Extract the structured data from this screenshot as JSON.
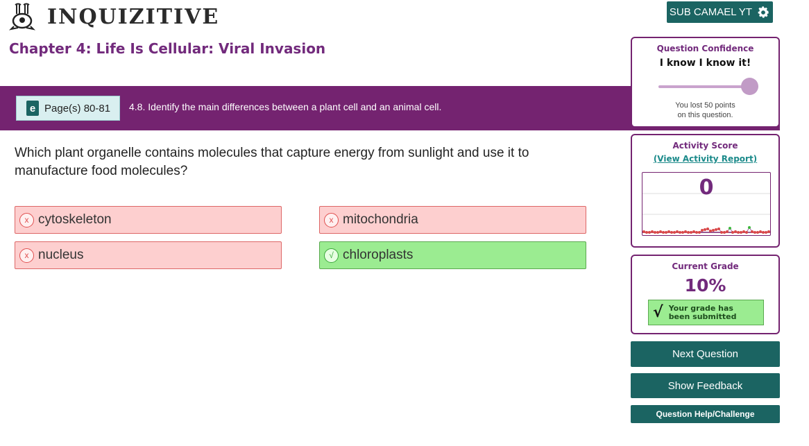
{
  "header": {
    "logo_text": "INQUIZITIVE",
    "user_button_label": "SUB CAMAEL YT",
    "user_button_icon": "gear-icon"
  },
  "chapter": {
    "title": "Chapter 4: Life Is Cellular: Viral Invasion"
  },
  "objective_bar": {
    "page_ref": "Page(s) 80-81",
    "page_icon": "ebook-icon",
    "objective": "4.8. Identify the main differences between a plant cell and an animal cell."
  },
  "question": {
    "text": "Which plant organelle contains molecules that capture energy from sunlight and use it to manufacture food molecules?"
  },
  "answers": [
    {
      "label": "cytoskeleton",
      "status": "incorrect",
      "mark": "x"
    },
    {
      "label": "mitochondria",
      "status": "incorrect",
      "mark": "x"
    },
    {
      "label": "nucleus",
      "status": "incorrect",
      "mark": "x"
    },
    {
      "label": "chloroplasts",
      "status": "correct",
      "mark": "√"
    }
  ],
  "confidence": {
    "heading": "Question Confidence",
    "value": "I know I know it!",
    "slider_level": 1.0,
    "note_line1": "You lost 50 points",
    "note_line2": "on this question."
  },
  "activity": {
    "heading": "Activity Score",
    "link": "(View Activity Report)",
    "score": "0"
  },
  "grade": {
    "heading": "Current Grade",
    "value": "10%",
    "submitted_line1": "Your grade has",
    "submitted_line2": "been submitted",
    "check": "√"
  },
  "buttons": {
    "next": "Next Question",
    "feedback": "Show Feedback",
    "help": "Question Help/Challenge"
  },
  "colors": {
    "brand_purple": "#742370",
    "teal": "#1b6462",
    "incorrect_bg": "#fdcfcf",
    "correct_bg": "#9bec91"
  }
}
